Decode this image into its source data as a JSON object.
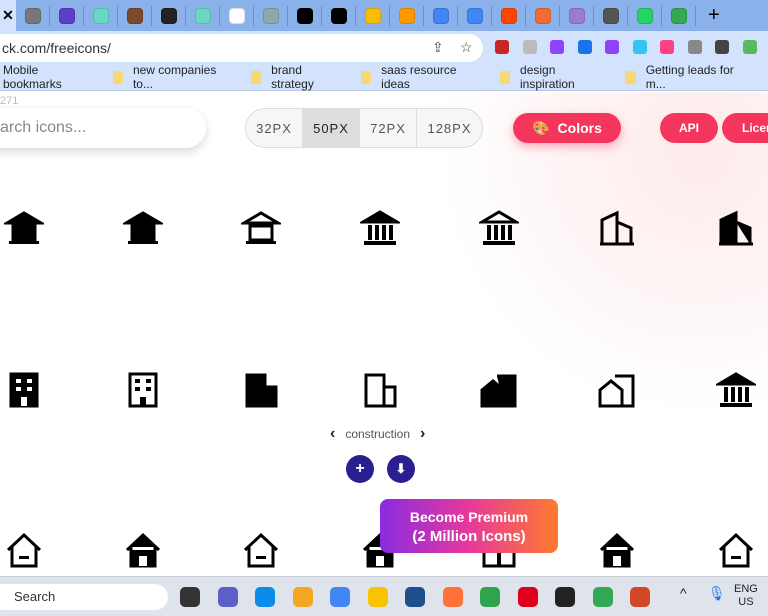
{
  "browser": {
    "tab_close": "✕",
    "new_tab": "+",
    "tab_favicons": [
      "#777",
      "#5b3fc4",
      "#6ad7c5",
      "#7a4a2a",
      "#222",
      "#6ad7c5",
      "#fff",
      "#8aa",
      "#000",
      "#000",
      "#fbbc04",
      "#ff9900",
      "#4285f4",
      "#4285f4",
      "#ff4500",
      "#f06a35",
      "#9b7bd1",
      "#555",
      "#25d366",
      "#34a853"
    ],
    "url": "ck.com/freeicons/",
    "extension_colors": [
      "#c62828",
      "#bbb",
      "#8e44ff",
      "#1a73e8",
      "#8e44ff",
      "#36c5f0",
      "#ff4081",
      "#888",
      "#444",
      "#5cb85c"
    ],
    "bookmarks": [
      "Mobile bookmarks",
      "new companies to...",
      "brand strategy",
      "saas resource ideas",
      "design inspiration",
      "Getting leads for m..."
    ]
  },
  "page": {
    "count_text": "271",
    "search_placeholder": "arch icons...",
    "sizes": [
      {
        "label": "32PX",
        "selected": false
      },
      {
        "label": "50PX",
        "selected": true
      },
      {
        "label": "72PX",
        "selected": false
      },
      {
        "label": "128PX",
        "selected": false
      }
    ],
    "colors_label": "Colors",
    "api_label": "API",
    "license_label": "Licen",
    "accent": "#f5365c",
    "icon_rows": [
      [
        "pagoda-icon",
        "temple-filled-icon",
        "temple-outline-icon",
        "bank-filled-icon",
        "bank-outline-icon",
        "building-outline-icon",
        "building-filled-icon"
      ],
      [
        "office-building-filled-icon",
        "office-building-outline-icon",
        "city-filled-icon",
        "city-outline-icon",
        "house-building-filled-icon",
        "house-building-outline-icon",
        "museum-icon"
      ],
      [
        "home-outline-icon",
        "home-filled-icon",
        "home-outline-icon",
        "home-filled-icon",
        "store-icon",
        "home-filled-icon",
        "home-outline-icon"
      ]
    ],
    "pager": {
      "prev": "‹",
      "category": "construction",
      "next": "›"
    },
    "add_label": "+",
    "download_label": "⬇",
    "premium": {
      "line1": "Become Premium",
      "line2": "(2 Million Icons)"
    }
  },
  "taskbar": {
    "search_label": "Search",
    "apps": [
      "#333",
      "#5b5fc7",
      "#0c8ce9",
      "#f5a623",
      "#4285f4",
      "#f8c300",
      "#1e4e8c",
      "#ff7139",
      "#2ea44f",
      "#e0001b",
      "#222",
      "#34a853",
      "#d24726"
    ],
    "tray_chevron": "^",
    "lang1": "ENG",
    "lang2": "US"
  }
}
